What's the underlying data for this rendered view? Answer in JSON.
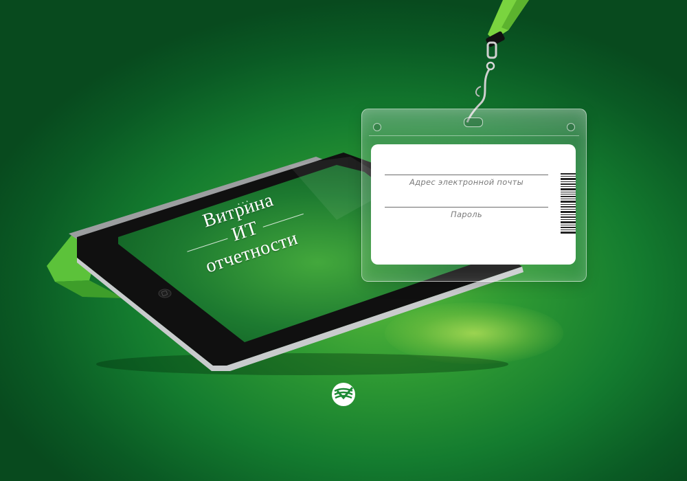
{
  "tablet": {
    "title_line1": "Витрина",
    "title_line2": "ИТ",
    "title_line3": "отчетности",
    "status_icons": "▪ ▪ ▪"
  },
  "badge": {
    "email_label": "Адрес электронной почты",
    "password_label": "Пароль"
  },
  "colors": {
    "background": "#147c2f",
    "accent": "#6fd23d",
    "card": "#ffffff"
  },
  "icons": {
    "logo": "sberbank-logo-icon",
    "barcode": "barcode-icon",
    "lanyard": "lanyard-icon"
  }
}
